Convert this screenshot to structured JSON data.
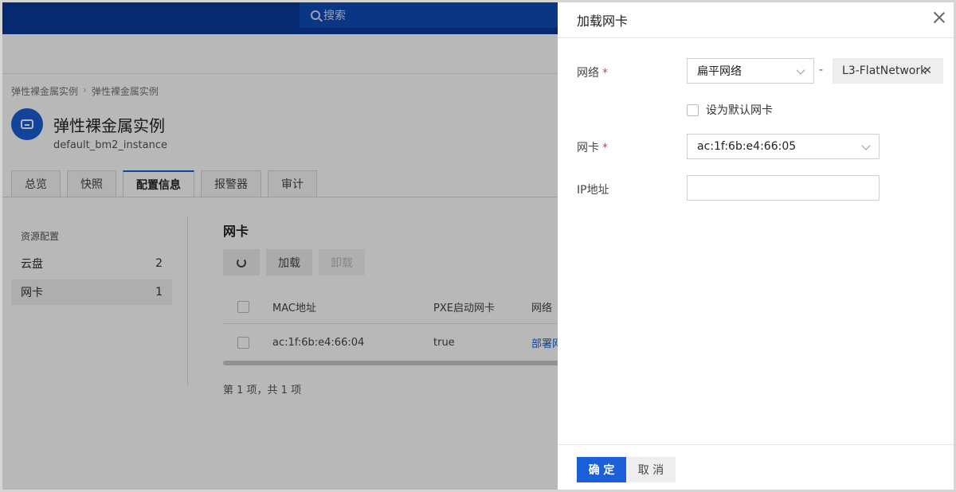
{
  "header": {
    "search_placeholder": "搜索"
  },
  "breadcrumb": [
    "弹性裸金属实例",
    "弹性裸金属实例"
  ],
  "page": {
    "title": "弹性裸金属实例",
    "subtitle": "default_bm2_instance"
  },
  "tabs": [
    "总览",
    "快照",
    "配置信息",
    "报警器",
    "审计"
  ],
  "active_tab": "配置信息",
  "sidebar": {
    "title": "资源配置",
    "items": [
      {
        "label": "云盘",
        "count": "2"
      },
      {
        "label": "网卡",
        "count": "1"
      }
    ]
  },
  "section": {
    "title": "网卡",
    "buttons": {
      "load": "加载",
      "unload": "卸载"
    },
    "columns": [
      "MAC地址",
      "PXE启动网卡",
      "网络"
    ],
    "rows": [
      {
        "mac": "ac:1f:6b:e4:66:04",
        "pxe": "true",
        "network": "部署网"
      }
    ],
    "pager": "第 1 项，共 1 项"
  },
  "drawer": {
    "title": "加载网卡",
    "network_label": "网络",
    "network_type": "扁平网络",
    "network_tag": "L3-FlatNetwork",
    "separator": "-",
    "default_nic_label": "设为默认网卡",
    "nic_label": "网卡",
    "nic_value": "ac:1f:6b:e4:66:05",
    "ip_label": "IP地址",
    "ip_value": "",
    "confirm": "确 定",
    "cancel": "取 消"
  },
  "colors": {
    "primary": "#1b5fd9",
    "topbar": "#0b3a9a",
    "required": "#e23b3b"
  }
}
